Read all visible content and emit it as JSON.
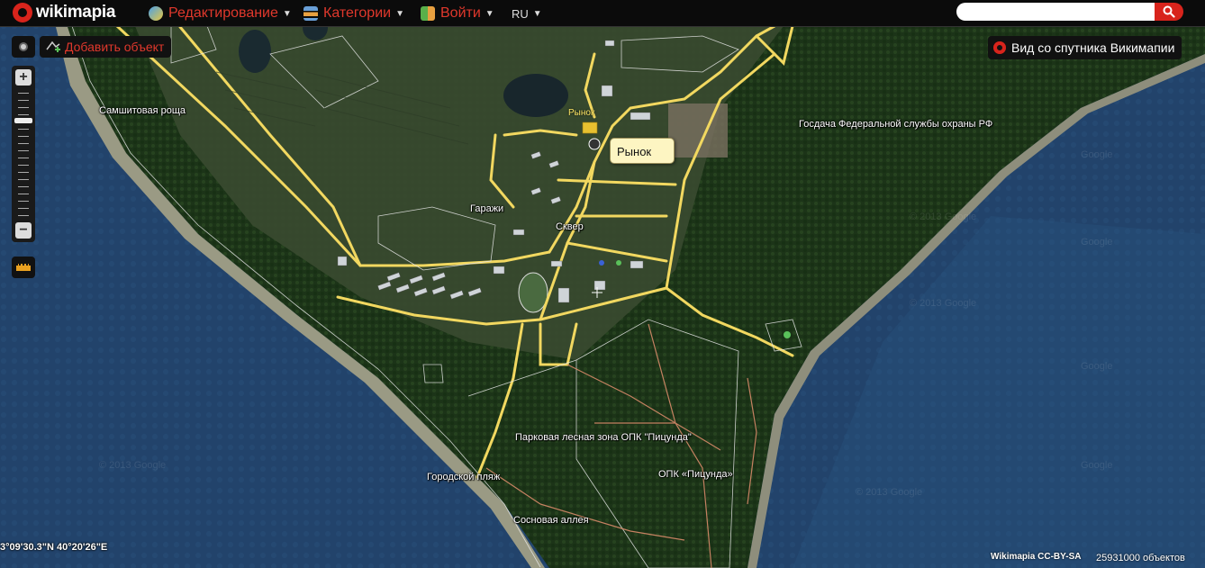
{
  "header": {
    "logo_text": "wikimapia",
    "menu": [
      {
        "label": "Редактирование",
        "icon": "edit-icon"
      },
      {
        "label": "Категории",
        "icon": "categories-icon"
      },
      {
        "label": "Войти",
        "icon": "login-icon"
      }
    ],
    "language": "RU",
    "search": {
      "value": "",
      "placeholder": ""
    }
  },
  "controls": {
    "add_object_label": "Добавить объект",
    "satellite_view_label": "Вид со спутника Викимапии",
    "zoom_in_label": "+",
    "zoom_out_label": "−"
  },
  "map": {
    "labels": [
      {
        "id": "samshitovaya",
        "text": "Самшитовая роща"
      },
      {
        "id": "gosdacha",
        "text": "Госдача Федеральной службы охраны РФ"
      },
      {
        "id": "garazhi",
        "text": "Гаражи"
      },
      {
        "id": "skver",
        "text": "Сквер"
      },
      {
        "id": "park",
        "text": "Парковая лесная зона ОПК \"Пицунда\""
      },
      {
        "id": "opk",
        "text": "ОПК «Пицунда»"
      },
      {
        "id": "beach",
        "text": "Городской пляж"
      },
      {
        "id": "alley",
        "text": "Сосновая аллея"
      }
    ],
    "market_pin_label": "Рынок",
    "tooltip": "Рынок",
    "coordinates": "3°09'30.3\"N 40°20'26\"E",
    "copyright": "Wikimapia CC-BY-SA",
    "object_count": "25931000 объектов",
    "colors": {
      "sea": "#24466e",
      "forest": "#1f3a1a",
      "road": "#f2d860",
      "land": "#3a4a30"
    }
  }
}
